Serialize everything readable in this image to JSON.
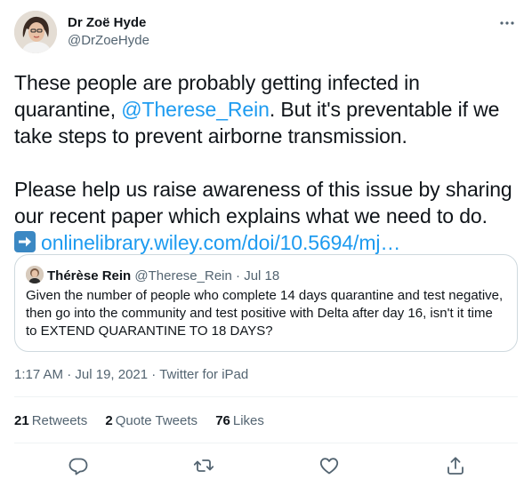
{
  "author": {
    "name": "Dr Zoë Hyde",
    "handle": "@DrZoeHyde"
  },
  "tweet": {
    "line1_pre": "These people are probably getting infected in quarantine, ",
    "mention": "@Therese_Rein",
    "line1_post": ". But it's preventable if we take steps to prevent airborne transmission.",
    "line2": "Please help us raise awareness of this issue by sharing our recent paper which explains what we need to do.",
    "link": "onlinelibrary.wiley.com/doi/10.5694/mj…"
  },
  "quote": {
    "name": "Thérèse Rein",
    "handle": "@Therese_Rein",
    "separator": "·",
    "date": "Jul 18",
    "text": "Given the number of people who complete 14 days quarantine and test negative, then go into the community and test positive with Delta after day 16, isn't it time to EXTEND QUARANTINE TO 18 DAYS?"
  },
  "meta": {
    "time": "1:17 AM",
    "date": "Jul 19, 2021",
    "source": "Twitter for iPad",
    "separator": "·"
  },
  "stats": {
    "retweets_count": "21",
    "retweets_label": "Retweets",
    "quotes_count": "2",
    "quotes_label": "Quote Tweets",
    "likes_count": "76",
    "likes_label": "Likes"
  },
  "icons": {
    "more": "more-horizontal-icon",
    "reply": "reply-icon",
    "retweet": "retweet-icon",
    "like": "like-icon",
    "share": "share-icon",
    "arrow": "right-arrow-emoji-icon"
  },
  "colors": {
    "accent": "#1d9bf0",
    "text": "#0f1419",
    "secondary": "#536471",
    "border": "#cfd9de"
  }
}
